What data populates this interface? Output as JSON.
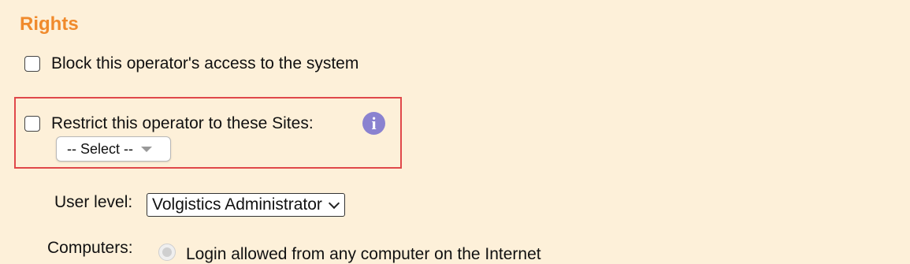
{
  "section": {
    "title": "Rights"
  },
  "block_access": {
    "label": "Block this operator's access to the system",
    "checked": false
  },
  "restrict_sites": {
    "label": "Restrict this operator to these Sites:",
    "checked": false,
    "info_icon": "info-icon",
    "select_value": "-- Select --"
  },
  "user_level": {
    "label": "User level:",
    "value": "Volgistics Administrator"
  },
  "computers": {
    "label": "Computers:",
    "option_label": "Login allowed from any computer on the Internet",
    "selected": true,
    "disabled": true
  },
  "colors": {
    "heading": "#f08a2c",
    "background": "#fdf0d9",
    "highlight_border": "#e0484a",
    "info_icon": "#8a82d0"
  }
}
